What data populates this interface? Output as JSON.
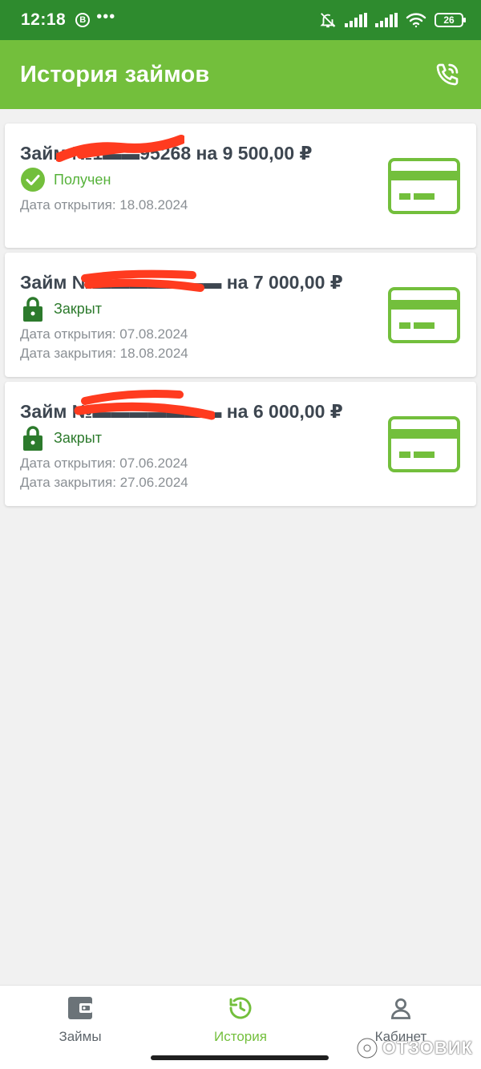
{
  "status_bar": {
    "time": "12:18",
    "notif_badge": "B",
    "overflow": "•••",
    "battery": "26",
    "icons": [
      "bell-off-icon",
      "signal-icon",
      "signal-icon",
      "wifi-icon",
      "battery-icon"
    ]
  },
  "app_bar": {
    "title": "История займов",
    "call_icon": "phone-call-icon"
  },
  "loans": [
    {
      "title": "Займ №1▬▬95268 на 9 500,00 ₽",
      "status": "Получен",
      "status_icon": "check-circle-icon",
      "opened": "Дата открытия: 18.08.2024",
      "closed": ""
    },
    {
      "title": "Займ №▬▬▬▬▬▬▬ на 7 000,00 ₽",
      "status": "Закрыт",
      "status_icon": "lock-icon",
      "opened": "Дата открытия: 07.08.2024",
      "closed": "Дата закрытия: 18.08.2024"
    },
    {
      "title": "Займ №▬▬▬▬▬▬▬ на 6 000,00 ₽",
      "status": "Закрыт",
      "status_icon": "lock-icon",
      "opened": "Дата открытия: 07.06.2024",
      "closed": "Дата закрытия: 27.06.2024"
    }
  ],
  "bottom_nav": [
    {
      "label": "Займы",
      "icon": "wallet-icon",
      "active": false
    },
    {
      "label": "История",
      "icon": "history-icon",
      "active": true
    },
    {
      "label": "Кабинет",
      "icon": "user-icon",
      "active": false
    }
  ],
  "watermark": "ОТЗОВИК",
  "colors": {
    "status_bar": "#2e8b2e",
    "app_bar": "#73bf3c",
    "accent": "#73bf3c",
    "closed_status": "#2c7a2c",
    "redaction": "#ff3b1f"
  }
}
